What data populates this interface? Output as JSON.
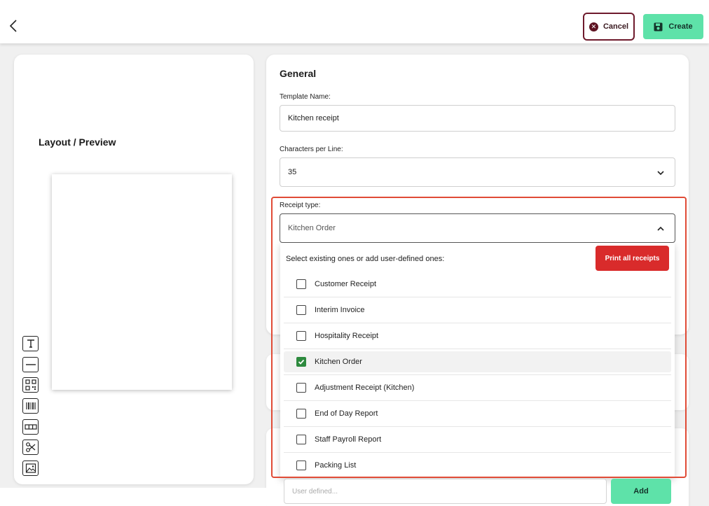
{
  "header": {
    "cancel_label": "Cancel",
    "create_label": "Create"
  },
  "preview": {
    "title": "Layout / Preview",
    "tools": [
      "text-tool-icon",
      "line-tool-icon",
      "qr-code-tool-icon",
      "barcode-tool-icon",
      "columns-tool-icon",
      "scissors-tool-icon",
      "image-tool-icon"
    ]
  },
  "general": {
    "title": "General",
    "template_name_label": "Template Name:",
    "template_name_value": "Kitchen receipt",
    "chars_label": "Characters per Line:",
    "chars_value": "35",
    "receipt_type_label": "Receipt type:",
    "receipt_type_value": "Kitchen Order"
  },
  "dropdown": {
    "hint": "Select existing ones or add user-defined ones:",
    "print_all_label": "Print all receipts",
    "options": [
      {
        "label": "Customer Receipt",
        "checked": false
      },
      {
        "label": "Interim Invoice",
        "checked": false
      },
      {
        "label": "Hospitality Receipt",
        "checked": false
      },
      {
        "label": "Kitchen Order",
        "checked": true
      },
      {
        "label": "Adjustment Receipt (Kitchen)",
        "checked": false
      },
      {
        "label": "End of Day Report",
        "checked": false
      },
      {
        "label": "Staff Payroll Report",
        "checked": false
      },
      {
        "label": "Packing List",
        "checked": false
      }
    ],
    "user_defined_placeholder": "User defined...",
    "add_label": "Add"
  },
  "colors": {
    "accent_green": "#5ee2a9",
    "danger_red": "#d92b2b",
    "highlight": "#e04b36",
    "checkbox_checked": "#2d8a3e",
    "cancel_border": "#6e1a2c"
  }
}
